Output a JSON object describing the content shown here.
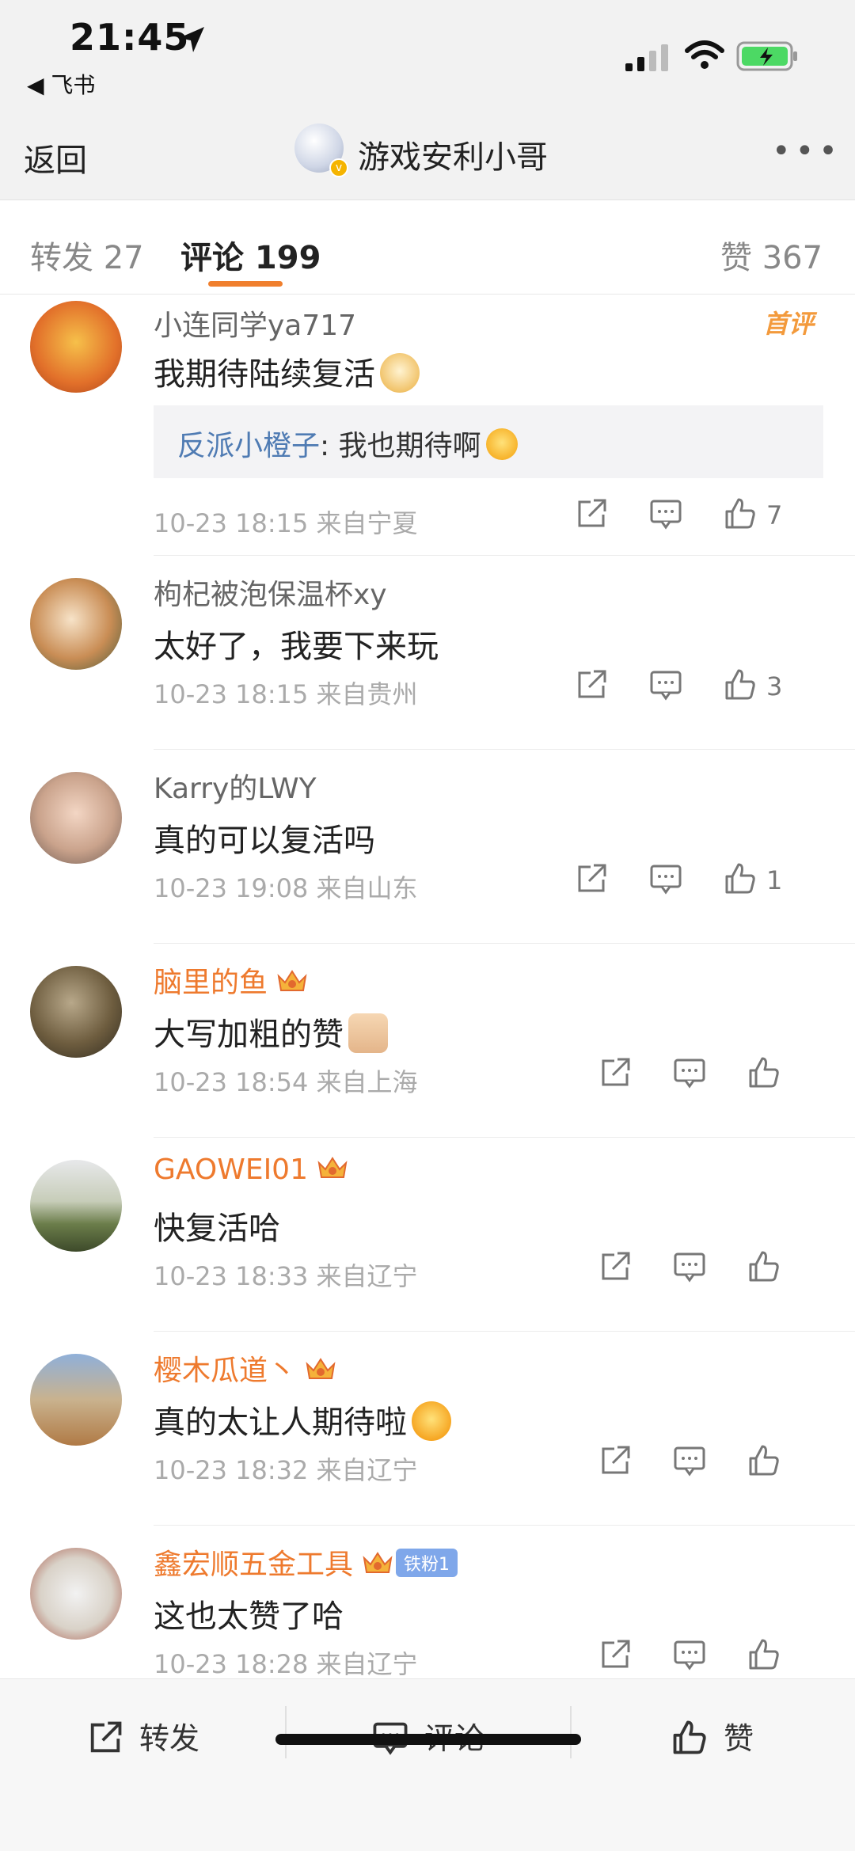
{
  "status_bar": {
    "time": "21:45",
    "back_app": "◀ 飞书"
  },
  "nav": {
    "back_label": "返回",
    "title": "游戏安利小哥",
    "verified_badge": "v",
    "more": "•••"
  },
  "tabs": {
    "repost": "转发 27",
    "comment": "评论 199",
    "like": "赞 367"
  },
  "comments": [
    {
      "name": "小连同学ya717",
      "text": "我期待陆续复活",
      "emoji": "doge-emoji",
      "first_tag": "首评",
      "reply_name": "反派小橙子",
      "reply_text": ": 我也期待啊",
      "meta": "10-23 18:15  来自宁夏",
      "likes": "7"
    },
    {
      "name": "枸杞被泡保温杯xy",
      "text": "太好了，我要下来玩",
      "meta": "10-23 18:15  来自贵州",
      "likes": "3"
    },
    {
      "name": "Karry的LWY",
      "text": "真的可以复活吗",
      "meta": "10-23 19:08  来自山东",
      "likes": "1"
    },
    {
      "name": "脑里的鱼",
      "text": "大写加粗的赞",
      "emoji": "thumbs-up-emoji",
      "meta": "10-23 18:54  来自上海",
      "likes": ""
    },
    {
      "name": "GAOWEI01",
      "text": "快复活哈",
      "meta": "10-23 18:33  来自辽宁",
      "likes": ""
    },
    {
      "name": "樱木瓜道丶",
      "text": "真的太让人期待啦",
      "emoji": "crying-laughing-emoji",
      "meta": "10-23 18:32  来自辽宁",
      "likes": ""
    },
    {
      "name": "鑫宏顺五金工具",
      "badge": "铁粉1",
      "text": "这也太赞了哈",
      "meta": "10-23 18:28  来自辽宁",
      "likes": ""
    }
  ],
  "bottom_bar": {
    "repost": "转发",
    "comment": "评论",
    "like": "赞"
  },
  "colors": {
    "accent": "#f07f2d",
    "vip_name": "#ee7a2e",
    "link": "#4f7bb3",
    "meta": "#aaaaaa"
  }
}
